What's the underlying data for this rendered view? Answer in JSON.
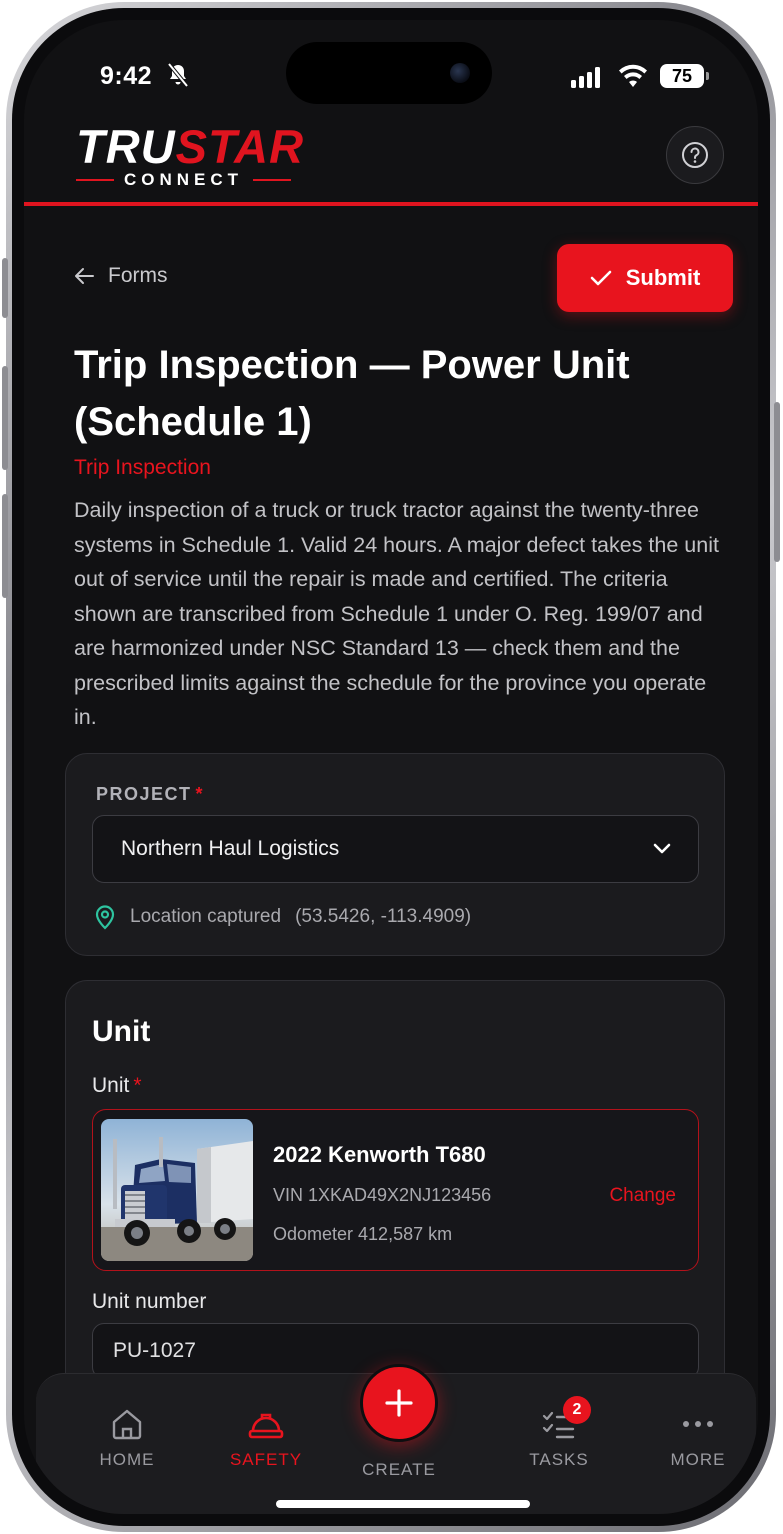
{
  "status_bar": {
    "time": "9:42",
    "battery": "75"
  },
  "brand": {
    "logo_part1": "TRU",
    "logo_part2": "STAR",
    "logo_sub": "CONNECT",
    "accent_color": "#e8141e"
  },
  "nav": {
    "back_label": "Forms",
    "submit_label": "Submit"
  },
  "form": {
    "title": "Trip Inspection — Power Unit (Schedule 1)",
    "category": "Trip Inspection",
    "description": "Daily inspection of a truck or truck tractor against the twenty-three systems in Schedule 1. Valid 24 hours. A major defect takes the unit out of service until the repair is made and certified. The criteria shown are transcribed from Schedule 1 under O. Reg. 199/07 and are harmonized under NSC Standard 13 — check them and the prescribed limits against the schedule for the province you operate in."
  },
  "project": {
    "label": "PROJECT",
    "required_mark": "*",
    "selected": "Northern Haul Logistics",
    "location_text": "Location captured",
    "coordinates": "(53.5426, -113.4909)"
  },
  "unit_section": {
    "heading": "Unit",
    "unit_label": "Unit",
    "required_mark": "*",
    "vehicle": {
      "name": "2022 Kenworth T680",
      "vin": "VIN 1XKAD49X2NJ123456",
      "odometer": "Odometer 412,587 km",
      "change_label": "Change"
    },
    "unit_number_label": "Unit number",
    "unit_number_value": "PU-1027"
  },
  "tab_bar": {
    "tabs": [
      {
        "label": "HOME",
        "icon": "home-icon"
      },
      {
        "label": "SAFETY",
        "icon": "hard-hat-icon",
        "active": true
      },
      {
        "label": "CREATE",
        "icon": "plus-icon"
      },
      {
        "label": "TASKS",
        "icon": "checklist-icon",
        "badge": "2"
      },
      {
        "label": "MORE",
        "icon": "ellipsis-icon"
      }
    ]
  }
}
